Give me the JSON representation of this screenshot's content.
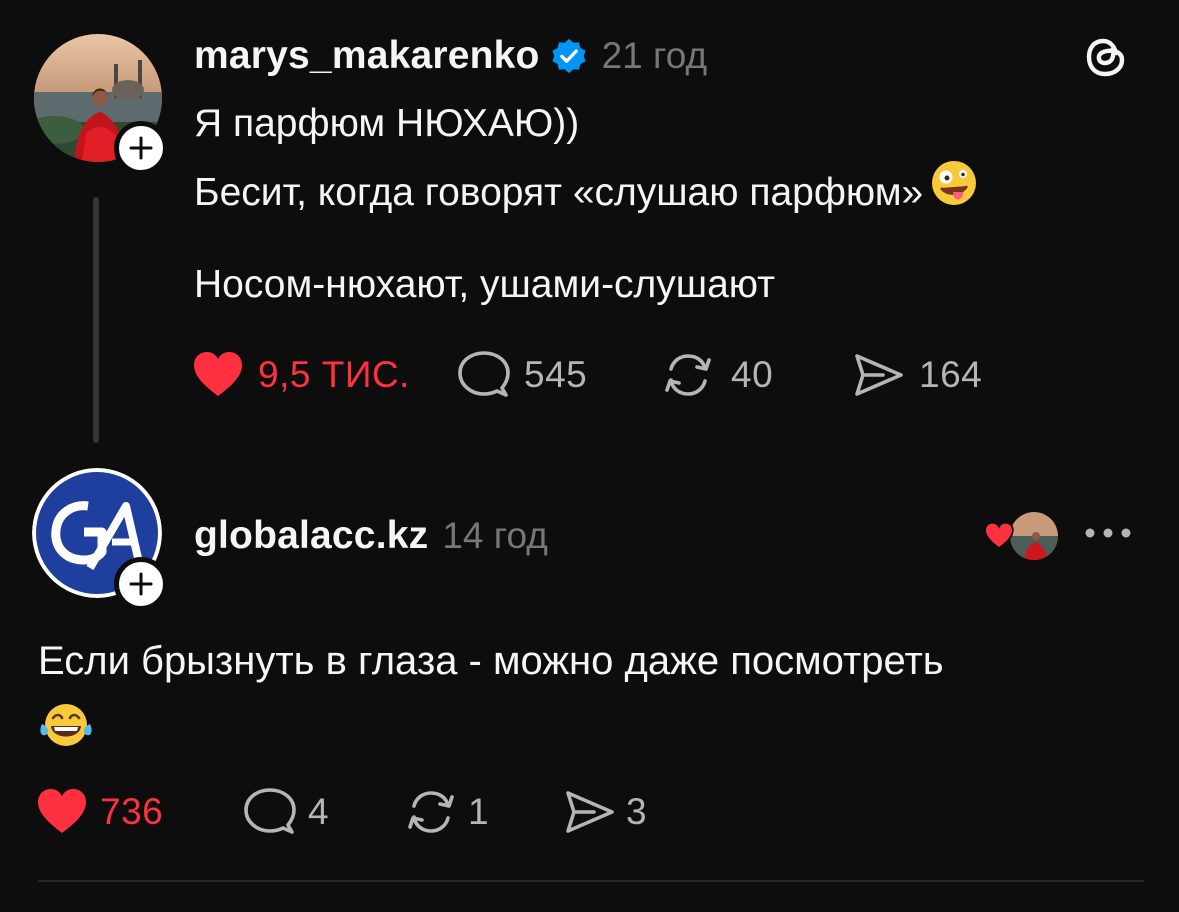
{
  "colors": {
    "background": "#0d0d0d",
    "text": "#f3f5f7",
    "muted": "#777777",
    "like_red": "#ff3040",
    "verified_blue": "#0095f6"
  },
  "post": {
    "username": "marys_makarenko",
    "verified": true,
    "time": "21 год",
    "text_line1": "Я парфюм НЮХАЮ))",
    "text_line2": "Бесит, когда говорят «слушаю парфюм»",
    "text_line2_emoji": "zany-face-emoji",
    "text_line3": "Носом-нюхают, ушами-слушают",
    "likes": "9,5 тис.",
    "liked": true,
    "replies": "545",
    "reposts": "40",
    "shares": "164"
  },
  "reply": {
    "username": "globalacc.kz",
    "time": "14 год",
    "text": "Если брызнуть в глаза - можно даже посмотреть",
    "text_emoji": "tears-of-joy-emoji",
    "likes": "736",
    "liked": true,
    "replies": "4",
    "reposts": "1",
    "shares": "3",
    "liked_by_author": true
  },
  "icons": {
    "app": "threads-logo-icon",
    "like": "heart-icon",
    "reply": "comment-bubble-icon",
    "repost": "repost-icon",
    "share": "send-icon",
    "more": "more-dots-icon",
    "follow": "plus-icon",
    "verified": "verified-badge-icon"
  }
}
